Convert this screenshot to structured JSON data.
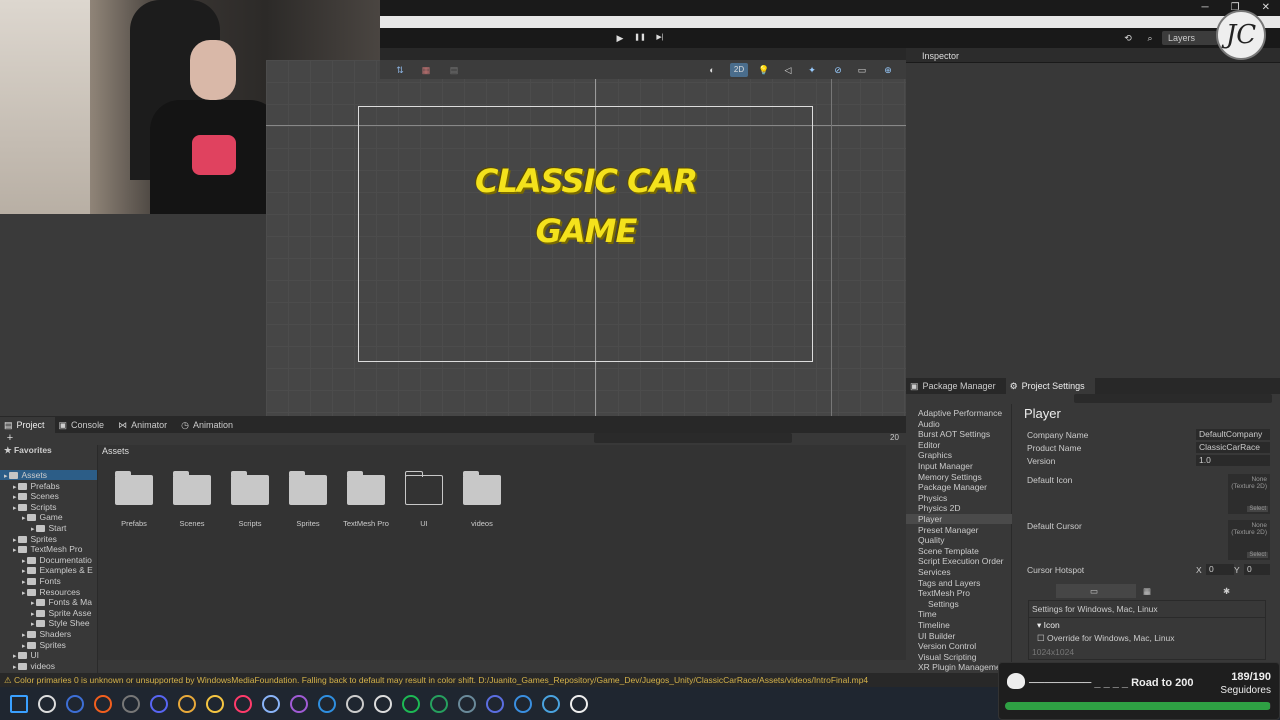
{
  "window": {
    "minimize": "─",
    "restore": "❐",
    "close": "✕"
  },
  "toolbar": {
    "layers_label": "Layers",
    "play": "▶",
    "pause": "❚❚",
    "step": "▶|"
  },
  "webcam": {
    "viewer_count": "1"
  },
  "scene": {
    "title_line1": "CLASSIC CAR",
    "title_line2": "GAME",
    "mode_2d": "2D"
  },
  "inspector": {
    "tab_label": "Inspector"
  },
  "project": {
    "tabs": [
      "Project",
      "Console",
      "Animator",
      "Animation"
    ],
    "favorites": "Favorites",
    "breadcrumb": "Assets",
    "hidden_count": "20",
    "tree": [
      {
        "label": "Assets",
        "indent": 0,
        "selected": true
      },
      {
        "label": "Prefabs",
        "indent": 1
      },
      {
        "label": "Scenes",
        "indent": 1
      },
      {
        "label": "Scripts",
        "indent": 1
      },
      {
        "label": "Game",
        "indent": 2
      },
      {
        "label": "Start",
        "indent": 3
      },
      {
        "label": "Sprites",
        "indent": 1
      },
      {
        "label": "TextMesh Pro",
        "indent": 1
      },
      {
        "label": "Documentatio",
        "indent": 2
      },
      {
        "label": "Examples & E",
        "indent": 2
      },
      {
        "label": "Fonts",
        "indent": 2
      },
      {
        "label": "Resources",
        "indent": 2
      },
      {
        "label": "Fonts & Ma",
        "indent": 3
      },
      {
        "label": "Sprite Asse",
        "indent": 3
      },
      {
        "label": "Style Shee",
        "indent": 3
      },
      {
        "label": "Shaders",
        "indent": 2
      },
      {
        "label": "Sprites",
        "indent": 2
      },
      {
        "label": "UI",
        "indent": 1
      },
      {
        "label": "videos",
        "indent": 1
      },
      {
        "label": "Packages",
        "indent": 0
      }
    ],
    "folders": [
      {
        "label": "Prefabs",
        "empty": false
      },
      {
        "label": "Scenes",
        "empty": false
      },
      {
        "label": "Scripts",
        "empty": false
      },
      {
        "label": "Sprites",
        "empty": false
      },
      {
        "label": "TextMesh Pro",
        "empty": false
      },
      {
        "label": "UI",
        "empty": true
      },
      {
        "label": "videos",
        "empty": false
      }
    ]
  },
  "status": {
    "message": "⚠ Color primaries 0 is unknown or unsupported by WindowsMediaFoundation. Falling back to default may result in color shift. D:/Juanito_Games_Repository/Game_Dev/Juegos_Unity/ClassicCarRace/Assets/videos/IntroFinal.mp4"
  },
  "project_settings": {
    "tabs": [
      "Package Manager",
      "Project Settings"
    ],
    "list": [
      "Adaptive Performance",
      "Audio",
      "Burst AOT Settings",
      "Editor",
      "Graphics",
      "Input Manager",
      "Memory Settings",
      "Package Manager",
      "Physics",
      "Physics 2D",
      "Player",
      "Preset Manager",
      "Quality",
      "Scene Template",
      "Script Execution Order",
      "Services",
      "Tags and Layers",
      "TextMesh Pro",
      "Settings",
      "Time",
      "Timeline",
      "UI Builder",
      "Version Control",
      "Visual Scripting",
      "XR Plugin Manageme"
    ],
    "selected": "Player",
    "heading": "Player",
    "company_label": "Company Name",
    "company_value": "DefaultCompany",
    "product_label": "Product Name",
    "product_value": "ClassicCarRace",
    "version_label": "Version",
    "version_value": "1.0",
    "icon_label": "Default Icon",
    "cursor_label": "Default Cursor",
    "slot_text": "None\n(Texture 2D)",
    "slot_select": "Select",
    "hotspot_label": "Cursor Hotspot",
    "hotspot_x_label": "X",
    "hotspot_x": "0",
    "hotspot_y_label": "Y",
    "hotspot_y": "0",
    "platform_heading": "Settings for Windows, Mac, Linux",
    "icon_section": "Icon",
    "override_label": "Override for Windows, Mac, Linux",
    "size_label": "1024x1024"
  },
  "road": {
    "text": "Road to 200",
    "count": "189/190",
    "sub": "Seguidores",
    "progress": 0.995
  },
  "avatar": {
    "initials": "JC"
  },
  "taskbar": {
    "apps": [
      "windows-icon",
      "search-icon",
      "v-icon",
      "brave-icon",
      "obs-icon",
      "discord-icon",
      "chrome-icon",
      "folder-icon",
      "jetbrains-icon",
      "unity-hub-icon",
      "visual-studio-icon",
      "vscode-icon",
      "unity-icon",
      "github-icon",
      "spotify-icon",
      "xbox-icon",
      "terminal-icon",
      "teams-icon",
      "pen-icon",
      "notepad-icon",
      "unity-editor-icon"
    ]
  }
}
